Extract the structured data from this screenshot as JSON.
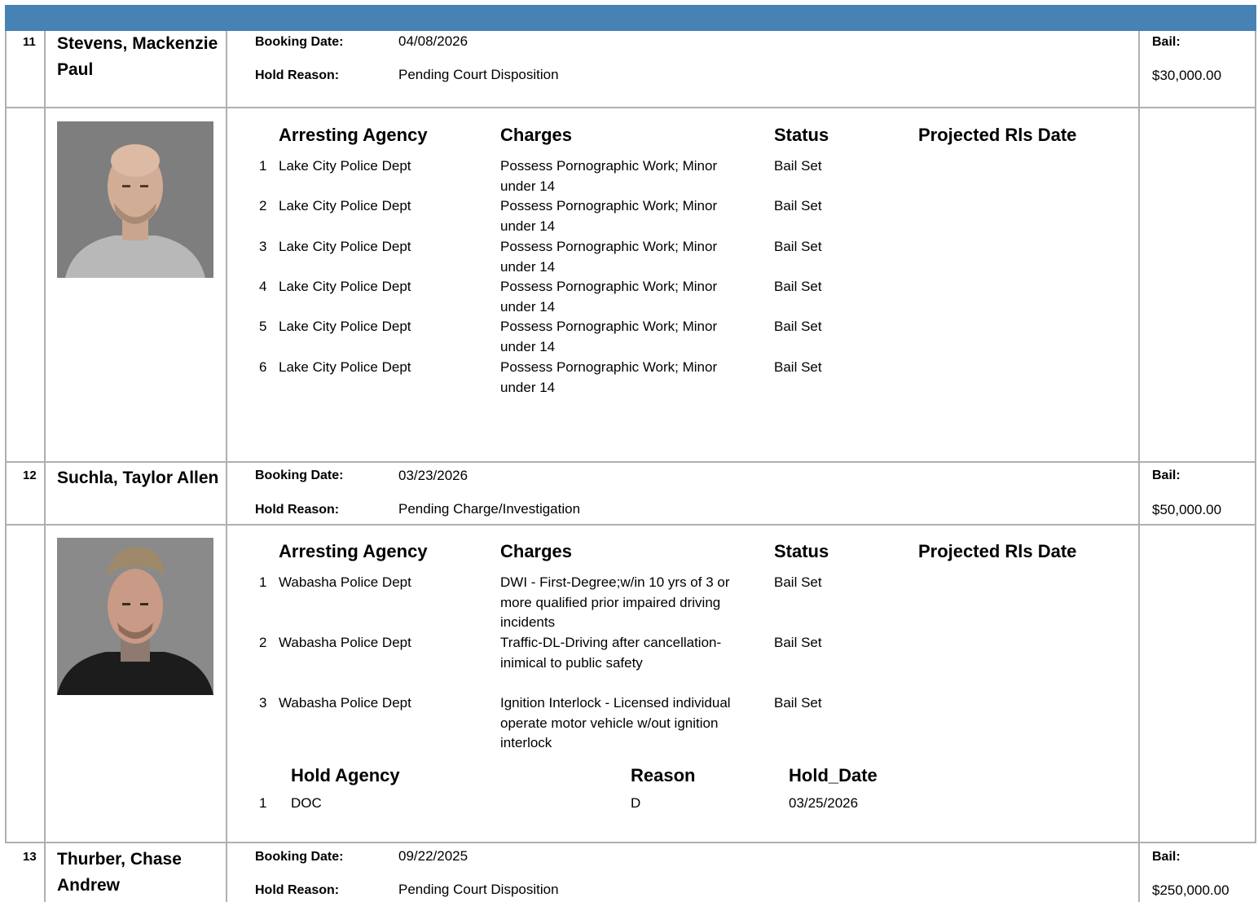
{
  "labels": {
    "booking_date": "Booking Date:",
    "hold_reason": "Hold Reason:",
    "bail": "Bail:",
    "arresting_agency": "Arresting Agency",
    "charges": "Charges",
    "status": "Status",
    "projected_rls_date": "Projected Rls Date",
    "hold_agency": "Hold Agency",
    "reason": "Reason",
    "hold_date": "Hold_Date"
  },
  "inmates": [
    {
      "num": "11",
      "name": "Stevens, Mackenzie Paul",
      "booking_date": "04/08/2026",
      "hold_reason": "Pending Court Disposition",
      "bail": "$30,000.00",
      "charges": [
        {
          "n": "1",
          "agency": "Lake City Police Dept",
          "charge": "Possess Pornographic Work; Minor under 14",
          "status": "Bail Set"
        },
        {
          "n": "2",
          "agency": "Lake City Police Dept",
          "charge": "Possess Pornographic Work; Minor under 14",
          "status": "Bail Set"
        },
        {
          "n": "3",
          "agency": "Lake City Police Dept",
          "charge": "Possess Pornographic Work; Minor under 14",
          "status": "Bail Set"
        },
        {
          "n": "4",
          "agency": "Lake City Police Dept",
          "charge": "Possess Pornographic Work; Minor under 14",
          "status": "Bail Set"
        },
        {
          "n": "5",
          "agency": "Lake City Police Dept",
          "charge": "Possess Pornographic Work; Minor under 14",
          "status": "Bail Set"
        },
        {
          "n": "6",
          "agency": "Lake City Police Dept",
          "charge": "Possess Pornographic Work; Minor under 14",
          "status": "Bail Set"
        }
      ]
    },
    {
      "num": "12",
      "name": "Suchla, Taylor Allen",
      "booking_date": "03/23/2026",
      "hold_reason": "Pending Charge/Investigation",
      "bail": "$50,000.00",
      "charges": [
        {
          "n": "1",
          "agency": "Wabasha Police Dept",
          "charge": "DWI - First-Degree;w/in 10 yrs of 3 or more qualified prior impaired driving incidents",
          "status": "Bail Set"
        },
        {
          "n": "2",
          "agency": "Wabasha Police Dept",
          "charge": "Traffic-DL-Driving after cancellation-inimical to public safety",
          "status": "Bail Set"
        },
        {
          "n": "3",
          "agency": "Wabasha Police Dept",
          "charge": "Ignition Interlock - Licensed individual operate motor vehicle w/out ignition interlock",
          "status": "Bail Set"
        }
      ],
      "holds": [
        {
          "n": "1",
          "agency": "DOC",
          "reason": "D",
          "date": "03/25/2026"
        }
      ]
    },
    {
      "num": "13",
      "name": "Thurber, Chase Andrew",
      "booking_date": "09/22/2025",
      "hold_reason": "Pending Court Disposition",
      "bail": "$250,000.00"
    }
  ]
}
